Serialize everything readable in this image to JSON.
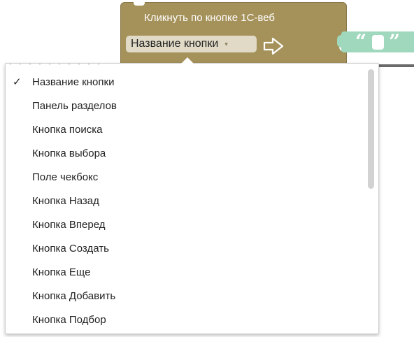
{
  "block": {
    "title": "Кликнуть по кнопке 1С-веб",
    "field_value": "Название кнопки",
    "field_arrow": "▾",
    "color": "#a5915a"
  },
  "text_block": {
    "open_quote": "“",
    "close_quote": "”",
    "color": "#a0d8bd"
  },
  "dropdown": {
    "selected_mark": "✓",
    "items": [
      {
        "label": "Название кнопки",
        "selected": true
      },
      {
        "label": "Панель разделов",
        "selected": false
      },
      {
        "label": "Кнопка поиска",
        "selected": false
      },
      {
        "label": "Кнопка выбора",
        "selected": false
      },
      {
        "label": "Поле чекбокс",
        "selected": false
      },
      {
        "label": "Кнопка Назад",
        "selected": false
      },
      {
        "label": "Кнопка Вперед",
        "selected": false
      },
      {
        "label": "Кнопка Создать",
        "selected": false
      },
      {
        "label": "Кнопка Еще",
        "selected": false
      },
      {
        "label": "Кнопка Добавить",
        "selected": false
      },
      {
        "label": "Кнопка Подбор",
        "selected": false
      }
    ]
  }
}
